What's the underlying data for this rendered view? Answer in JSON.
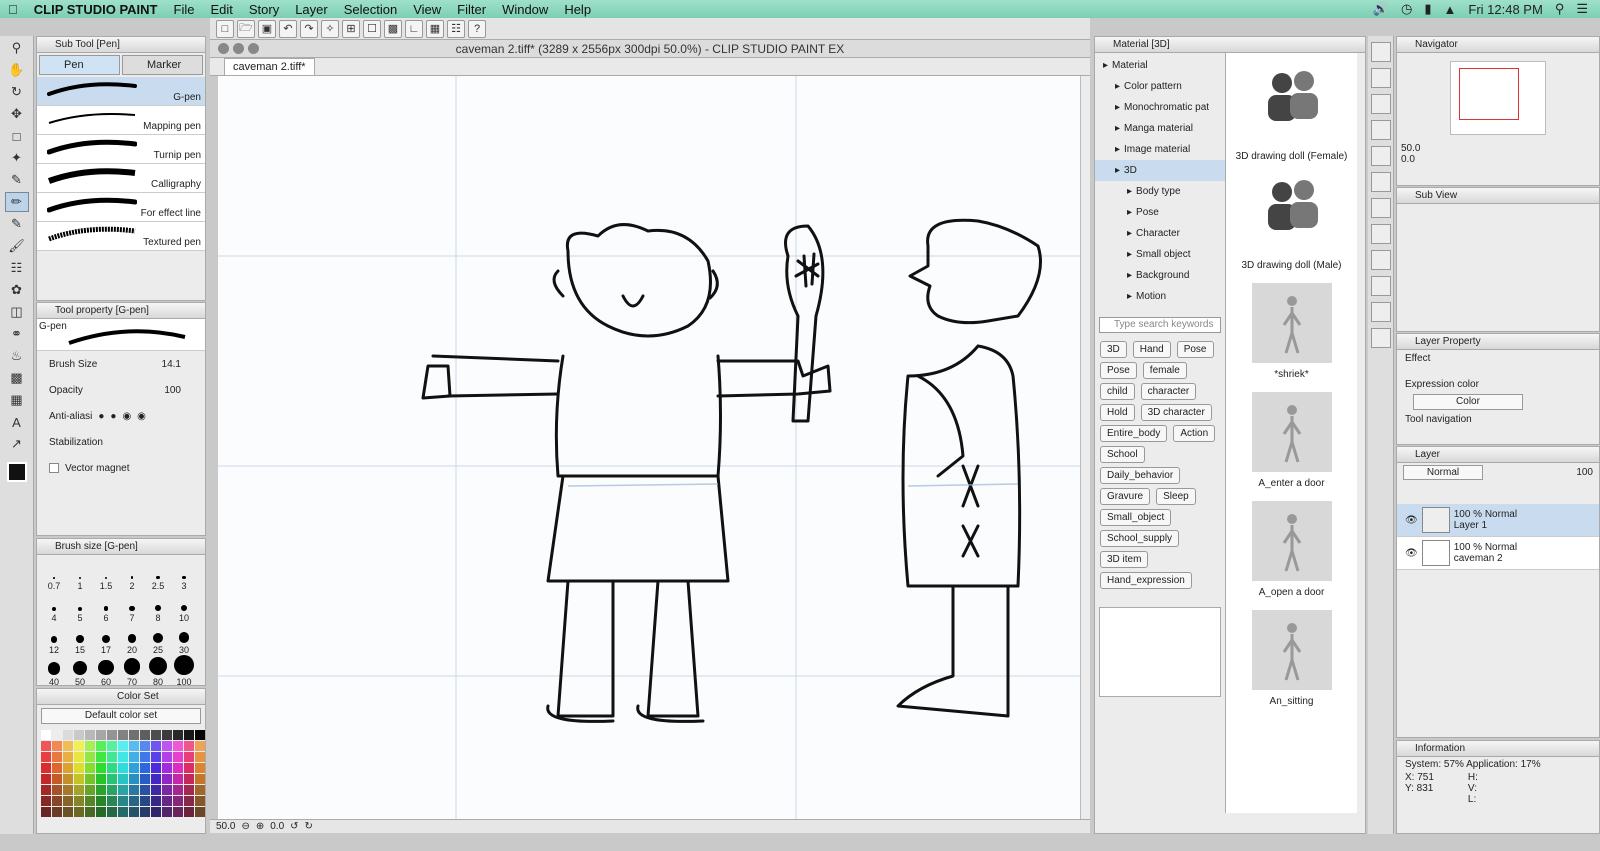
{
  "menubar": {
    "app": "CLIP STUDIO PAINT",
    "items": [
      "File",
      "Edit",
      "Story",
      "Layer",
      "Selection",
      "View",
      "Filter",
      "Window",
      "Help"
    ],
    "clock": "Fri 12:48 PM"
  },
  "window": {
    "title": "caveman 2.tiff* (3289 x 2556px 300dpi 50.0%)  - CLIP STUDIO PAINT EX",
    "tab": "caveman 2.tiff*"
  },
  "sub_tool": {
    "title": "Sub Tool [Pen]",
    "tabs": [
      "Pen",
      "Marker"
    ],
    "brushes": [
      "G-pen",
      "Mapping pen",
      "Turnip pen",
      "Calligraphy",
      "For effect line",
      "Textured pen"
    ]
  },
  "tool_property": {
    "title": "Tool property [G-pen]",
    "name": "G-pen",
    "brush_size_label": "Brush Size",
    "brush_size_value": "14.1",
    "opacity_label": "Opacity",
    "opacity_value": "100",
    "antialias_label": "Anti-aliasi",
    "stabilization_label": "Stabilization",
    "vector_magnet_label": "Vector magnet"
  },
  "brush_size": {
    "title": "Brush size [G-pen]",
    "sizes": [
      "0.7",
      "1",
      "1.5",
      "2",
      "2.5",
      "3",
      "4",
      "5",
      "6",
      "7",
      "8",
      "10",
      "12",
      "15",
      "17",
      "20",
      "25",
      "30",
      "40",
      "50",
      "60",
      "70",
      "80",
      "100"
    ]
  },
  "color_set": {
    "title": "Color Set",
    "selected": "Default color set"
  },
  "status": {
    "zoom": "50.0",
    "rotation": "0.0"
  },
  "material": {
    "title": "Material [3D]",
    "tree": [
      {
        "label": "Material",
        "indent": 0
      },
      {
        "label": "Color pattern",
        "indent": 1
      },
      {
        "label": "Monochromatic pat",
        "indent": 1
      },
      {
        "label": "Manga material",
        "indent": 1
      },
      {
        "label": "Image material",
        "indent": 1
      },
      {
        "label": "3D",
        "indent": 1
      },
      {
        "label": "Body type",
        "indent": 2
      },
      {
        "label": "Pose",
        "indent": 2
      },
      {
        "label": "Character",
        "indent": 2
      },
      {
        "label": "Small object",
        "indent": 2
      },
      {
        "label": "Background",
        "indent": 2
      },
      {
        "label": "Motion",
        "indent": 2
      }
    ],
    "search_placeholder": "Type search keywords",
    "tags": [
      "3D",
      "Hand",
      "Pose",
      "Pose",
      "female",
      "child",
      "character",
      "Hold",
      "3D character",
      "Entire_body",
      "Action",
      "School",
      "Daily_behavior",
      "Gravure",
      "Sleep",
      "Small_object",
      "School_supply",
      "3D item",
      "Hand_expression"
    ],
    "items": [
      "3D drawing doll (Female)",
      "3D drawing doll (Male)",
      "*shriek*",
      "A_enter a door",
      "A_open a door",
      "An_sitting"
    ]
  },
  "navigator": {
    "title": "Navigator",
    "zoom": "50.0",
    "rotation": "0.0"
  },
  "sub_view": {
    "title": "Sub View"
  },
  "layer_property": {
    "title": "Layer Property",
    "effect_label": "Effect",
    "expression_label": "Expression color",
    "expression_value": "Color",
    "tool_nav_label": "Tool navigation"
  },
  "layer": {
    "title": "Layer",
    "blend": "Normal",
    "opacity": "100",
    "layers": [
      {
        "info": "100 % Normal",
        "name": "Layer 1"
      },
      {
        "info": "100 % Normal",
        "name": "caveman 2"
      }
    ]
  },
  "information": {
    "title": "Information",
    "system": "System: 57% Application: 17%",
    "x": "X: 751",
    "y": "Y: 831",
    "h": "H:",
    "v": "V:",
    "l": "L:"
  }
}
